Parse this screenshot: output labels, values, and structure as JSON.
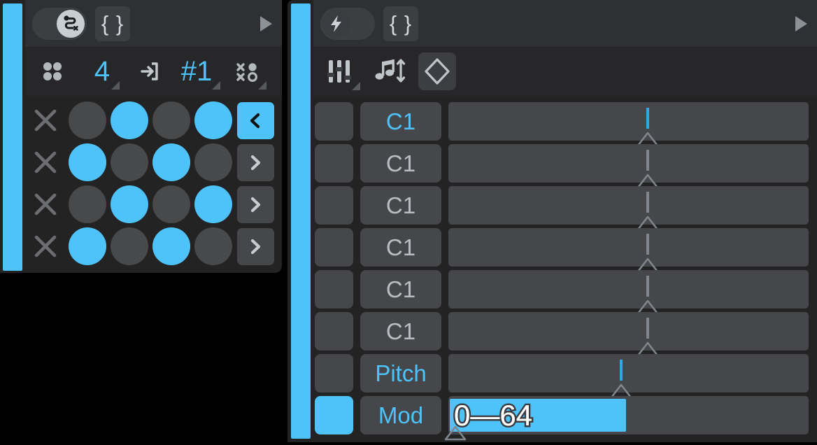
{
  "left_panel": {
    "accent_color": "#4ec3fa",
    "header": {
      "toggle": {
        "state": "on",
        "icon": "route-x-icon",
        "label": ""
      },
      "braces_button": {
        "label": "{ }",
        "icon": "braces-icon"
      },
      "play_button": {
        "icon": "play-triangle-icon"
      }
    },
    "toolbar": {
      "items": [
        {
          "name": "grid-dots-icon",
          "icon": "grid-4-dots-icon",
          "value": ""
        },
        {
          "name": "steps-value",
          "icon": "",
          "value": "4",
          "has_corner": true
        },
        {
          "name": "input-arrow-icon",
          "icon": "arrow-into-box-icon",
          "value": ""
        },
        {
          "name": "pattern-number",
          "icon": "",
          "value": "#1",
          "has_corner": true
        },
        {
          "name": "randomize-icon",
          "icon": "x-dot-matrix-icon",
          "value": "",
          "has_corner": true
        }
      ]
    },
    "matrix": {
      "rows": [
        {
          "clear_icon": "x-icon",
          "steps": [
            false,
            true,
            false,
            true
          ],
          "arrow": {
            "glyph": "‹",
            "active": true
          }
        },
        {
          "clear_icon": "x-icon",
          "steps": [
            true,
            false,
            true,
            false
          ],
          "arrow": {
            "glyph": "›",
            "active": false
          }
        },
        {
          "clear_icon": "x-icon",
          "steps": [
            false,
            true,
            false,
            true
          ],
          "arrow": {
            "glyph": "›",
            "active": false
          }
        },
        {
          "clear_icon": "x-icon",
          "steps": [
            true,
            false,
            true,
            false
          ],
          "arrow": {
            "glyph": "›",
            "active": false
          }
        }
      ]
    }
  },
  "right_panel": {
    "accent_color": "#4ec3fa",
    "header": {
      "toggle": {
        "state": "off",
        "icon": "lightning-bolt-icon",
        "label": ""
      },
      "braces_button": {
        "label": "{ }",
        "icon": "braces-icon"
      },
      "play_button": {
        "icon": "play-triangle-icon"
      }
    },
    "toolbar": {
      "items": [
        {
          "name": "faders-icon",
          "icon": "three-faders-icon",
          "has_corner": true,
          "selected": false
        },
        {
          "name": "note-transpose-icon",
          "icon": "music-note-updown-icon",
          "has_corner": false,
          "selected": false
        },
        {
          "name": "range-diamond-icon",
          "icon": "diamond-chevrons-icon",
          "has_corner": false,
          "selected": true
        }
      ]
    },
    "lanes": [
      {
        "led": false,
        "name": "C1",
        "name_accent": true,
        "marker": 55.4,
        "marker_accent": true,
        "type": "marker"
      },
      {
        "led": false,
        "name": "C1",
        "name_accent": false,
        "marker": 55.4,
        "marker_accent": false,
        "type": "marker"
      },
      {
        "led": false,
        "name": "C1",
        "name_accent": false,
        "marker": 55.4,
        "marker_accent": false,
        "type": "marker"
      },
      {
        "led": false,
        "name": "C1",
        "name_accent": false,
        "marker": 55.4,
        "marker_accent": false,
        "type": "marker"
      },
      {
        "led": false,
        "name": "C1",
        "name_accent": false,
        "marker": 55.4,
        "marker_accent": false,
        "type": "marker"
      },
      {
        "led": false,
        "name": "C1",
        "name_accent": false,
        "marker": 55.4,
        "marker_accent": false,
        "type": "marker"
      },
      {
        "led": false,
        "name": "Pitch",
        "name_accent": true,
        "marker": 48.0,
        "marker_accent": true,
        "type": "marker"
      },
      {
        "led": true,
        "name": "Mod",
        "name_accent": true,
        "marker": 2.0,
        "marker_accent": false,
        "type": "bar",
        "bar_width": 49.0,
        "bar_label": "0—64",
        "range_low": "0",
        "range_high": "64"
      }
    ]
  }
}
